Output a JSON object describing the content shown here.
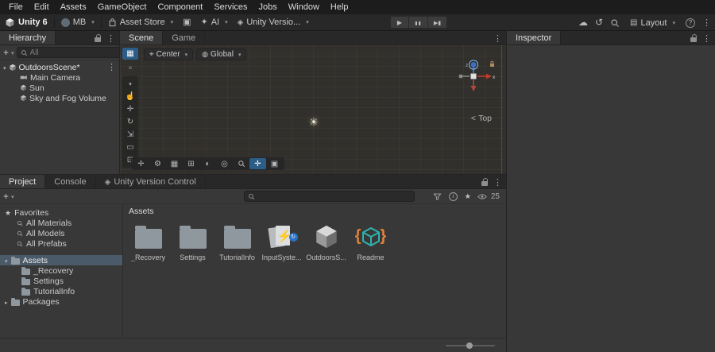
{
  "colors": {
    "accent": "#2c5d87",
    "selection": "#4a5a68",
    "folder": "#8f979f",
    "teal": "#2fb3ad",
    "orange": "#e2813a"
  },
  "menu": {
    "items": [
      "File",
      "Edit",
      "Assets",
      "GameObject",
      "Component",
      "Services",
      "Jobs",
      "Window",
      "Help"
    ]
  },
  "toolbar": {
    "product": "Unity 6",
    "account_label": "MB",
    "asset_store_label": "Asset Store",
    "ai_label": "AI",
    "version_label": "Unity Versio...",
    "layout_label": "Layout"
  },
  "hierarchy": {
    "tab_label": "Hierarchy",
    "search_placeholder": "All",
    "root": "OutdoorsScene*",
    "children": [
      "Main Camera",
      "Sun",
      "Sky and Fog Volume"
    ]
  },
  "scene": {
    "tab_scene": "Scene",
    "tab_game": "Game",
    "pivot_label": "Center",
    "space_label": "Global",
    "orientation_chevron": "<",
    "orientation_label": "Top",
    "axis_x_label": "x",
    "axis_z_label": "z"
  },
  "inspector": {
    "tab_label": "Inspector"
  },
  "project": {
    "tab_project": "Project",
    "tab_console": "Console",
    "tab_vcs": "Unity Version Control",
    "search_placeholder": "",
    "hidden_count": "25",
    "favorites_label": "Favorites",
    "favorites": [
      "All Materials",
      "All Models",
      "All Prefabs"
    ],
    "assets_label": "Assets",
    "asset_folders": [
      "_Recovery",
      "Settings",
      "TutorialInfo"
    ],
    "packages_label": "Packages",
    "grid_header": "Assets",
    "items": [
      {
        "label": "_Recovery"
      },
      {
        "label": "Settings"
      },
      {
        "label": "TutorialInfo"
      },
      {
        "label": "InputSyste..."
      },
      {
        "label": "OutdoorsS..."
      },
      {
        "label": "Readme"
      }
    ]
  }
}
